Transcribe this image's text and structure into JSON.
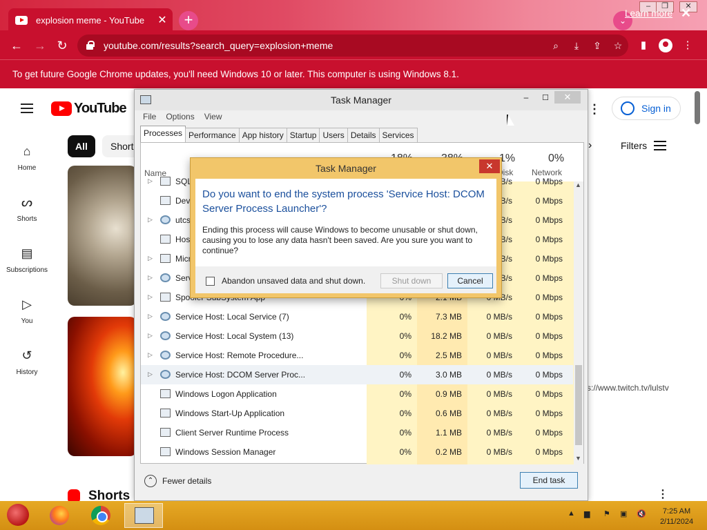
{
  "browser": {
    "tab_title": "explosion meme - YouTube",
    "tab_close": "✕",
    "new_tab": "+",
    "url": "youtube.com/results?search_query=explosion+meme",
    "infobar_text": "To get future Google Chrome updates, you'll need Windows 10 or later. This computer is using Windows 8.1.",
    "infobar_link": "Learn more",
    "accent_color": "#c8102e"
  },
  "youtube": {
    "logo_text": "YouTube",
    "sidebar": [
      {
        "label": "Home",
        "icon": "home-icon"
      },
      {
        "label": "Shorts",
        "icon": "shorts-icon"
      },
      {
        "label": "Subscriptions",
        "icon": "subscriptions-icon"
      },
      {
        "label": "You",
        "icon": "you-icon"
      },
      {
        "label": "History",
        "icon": "history-icon"
      }
    ],
    "chips": [
      "All",
      "Short"
    ],
    "signin": "Sign in",
    "filters": "Filters",
    "shorts_heading": "Shorts",
    "twitch_link": "s://www.twitch.tv/lulstv"
  },
  "task_manager": {
    "title": "Task Manager",
    "menu": [
      "File",
      "Options",
      "View"
    ],
    "tabs": [
      "Processes",
      "Performance",
      "App history",
      "Startup",
      "Users",
      "Details",
      "Services"
    ],
    "columns": {
      "name": "Name",
      "cpu_pct": "18%",
      "mem_pct": "38%",
      "disk_pct": "1%",
      "disk": "Disk",
      "net_pct": "0%",
      "network": "Network"
    },
    "rows": [
      {
        "name": "SQL",
        "cpu": "",
        "mem": "",
        "disk": "0 MB/s",
        "net": "0 Mbps"
      },
      {
        "name": "Devi",
        "cpu": "",
        "mem": "",
        "disk": "0 MB/s",
        "net": "0 Mbps"
      },
      {
        "name": "utcs",
        "cpu": "",
        "mem": "",
        "disk": "0 MB/s",
        "net": "0 Mbps"
      },
      {
        "name": "Host",
        "cpu": "",
        "mem": "",
        "disk": "0 MB/s",
        "net": "0 Mbps"
      },
      {
        "name": "Micr",
        "cpu": "",
        "mem": "",
        "disk": "0 MB/s",
        "net": "0 Mbps"
      },
      {
        "name": "Serv",
        "cpu": "",
        "mem": "",
        "disk": "0 MB/s",
        "net": "0 Mbps"
      },
      {
        "name": "Spooler SubSystem App",
        "cpu": "0%",
        "mem": "2.1 MB",
        "disk": "0 MB/s",
        "net": "0 Mbps"
      },
      {
        "name": "Service Host: Local Service (7)",
        "cpu": "0%",
        "mem": "7.3 MB",
        "disk": "0 MB/s",
        "net": "0 Mbps"
      },
      {
        "name": "Service Host: Local System (13)",
        "cpu": "0%",
        "mem": "18.2 MB",
        "disk": "0 MB/s",
        "net": "0 Mbps"
      },
      {
        "name": "Service Host: Remote Procedure...",
        "cpu": "0%",
        "mem": "2.5 MB",
        "disk": "0 MB/s",
        "net": "0 Mbps"
      },
      {
        "name": "Service Host: DCOM Server Proc...",
        "cpu": "0%",
        "mem": "3.0 MB",
        "disk": "0 MB/s",
        "net": "0 Mbps"
      },
      {
        "name": "Windows Logon Application",
        "cpu": "0%",
        "mem": "0.9 MB",
        "disk": "0 MB/s",
        "net": "0 Mbps"
      },
      {
        "name": "Windows Start-Up Application",
        "cpu": "0%",
        "mem": "0.6 MB",
        "disk": "0 MB/s",
        "net": "0 Mbps"
      },
      {
        "name": "Client Server Runtime Process",
        "cpu": "0%",
        "mem": "1.1 MB",
        "disk": "0 MB/s",
        "net": "0 Mbps"
      },
      {
        "name": "Windows Session Manager",
        "cpu": "0%",
        "mem": "0.2 MB",
        "disk": "0 MB/s",
        "net": "0 Mbps"
      }
    ],
    "fewer_details": "Fewer details",
    "end_task": "End task"
  },
  "dialog": {
    "title": "Task Manager",
    "close": "✕",
    "question": "Do you want to end the system process 'Service Host: DCOM Server Process Launcher'?",
    "message": "Ending this process will cause Windows to become unusable or shut down, causing you to lose any data hasn't been saved. Are you sure you want to continue?",
    "checkbox_label": "Abandon unsaved data and shut down.",
    "shutdown_button": "Shut down",
    "cancel_button": "Cancel"
  },
  "taskbar": {
    "time": "7:25 AM",
    "date": "2/11/2024"
  }
}
